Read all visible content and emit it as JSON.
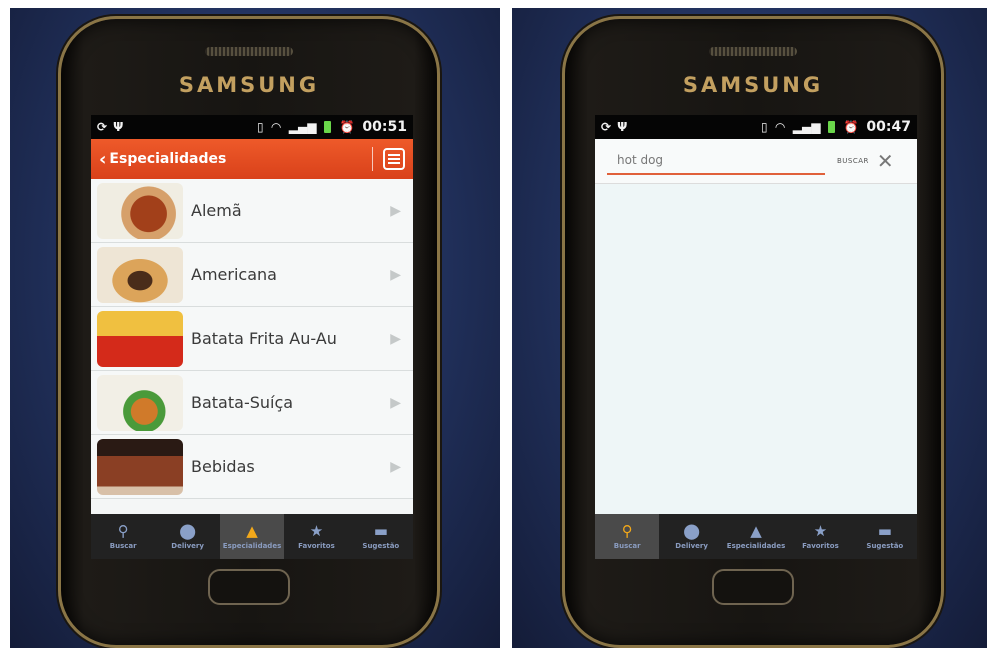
{
  "left_phone": {
    "brand": "SAMSUNG",
    "status": {
      "time": "00:51"
    },
    "action_bar": {
      "back_symbol": "‹",
      "title": "Especialidades",
      "menu_icon": "list-menu-icon"
    },
    "list_items": [
      {
        "label": "Alemã",
        "thumb": "food-photo-icon"
      },
      {
        "label": "Americana",
        "thumb": "food-photo-icon"
      },
      {
        "label": "Batata Frita Au-Au",
        "thumb": "food-photo-icon"
      },
      {
        "label": "Batata-Suíça",
        "thumb": "food-photo-icon"
      },
      {
        "label": "Bebidas",
        "thumb": "food-photo-icon"
      }
    ],
    "tabs": [
      {
        "label": "Buscar",
        "icon": "search-icon",
        "active": false
      },
      {
        "label": "Delivery",
        "icon": "map-pin-icon",
        "active": false
      },
      {
        "label": "Especialidades",
        "icon": "cloche-icon",
        "active": true
      },
      {
        "label": "Favoritos",
        "icon": "star-icon",
        "active": false
      },
      {
        "label": "Sugestão",
        "icon": "speech-bubble-icon",
        "active": false
      }
    ]
  },
  "right_phone": {
    "brand": "SAMSUNG",
    "status": {
      "time": "00:47"
    },
    "search": {
      "value": "hot dog",
      "button_label": "BUSCAR",
      "close_symbol": "✕"
    },
    "tabs": [
      {
        "label": "Buscar",
        "icon": "search-icon",
        "active": true
      },
      {
        "label": "Delivery",
        "icon": "map-pin-icon",
        "active": false
      },
      {
        "label": "Especialidades",
        "icon": "cloche-icon",
        "active": false
      },
      {
        "label": "Favoritos",
        "icon": "star-icon",
        "active": false
      },
      {
        "label": "Sugestão",
        "icon": "speech-bubble-icon",
        "active": false
      }
    ]
  },
  "colors": {
    "accent": "#e2502a",
    "tab_active": "#f2a81a",
    "brand_gold": "#c3a060"
  }
}
